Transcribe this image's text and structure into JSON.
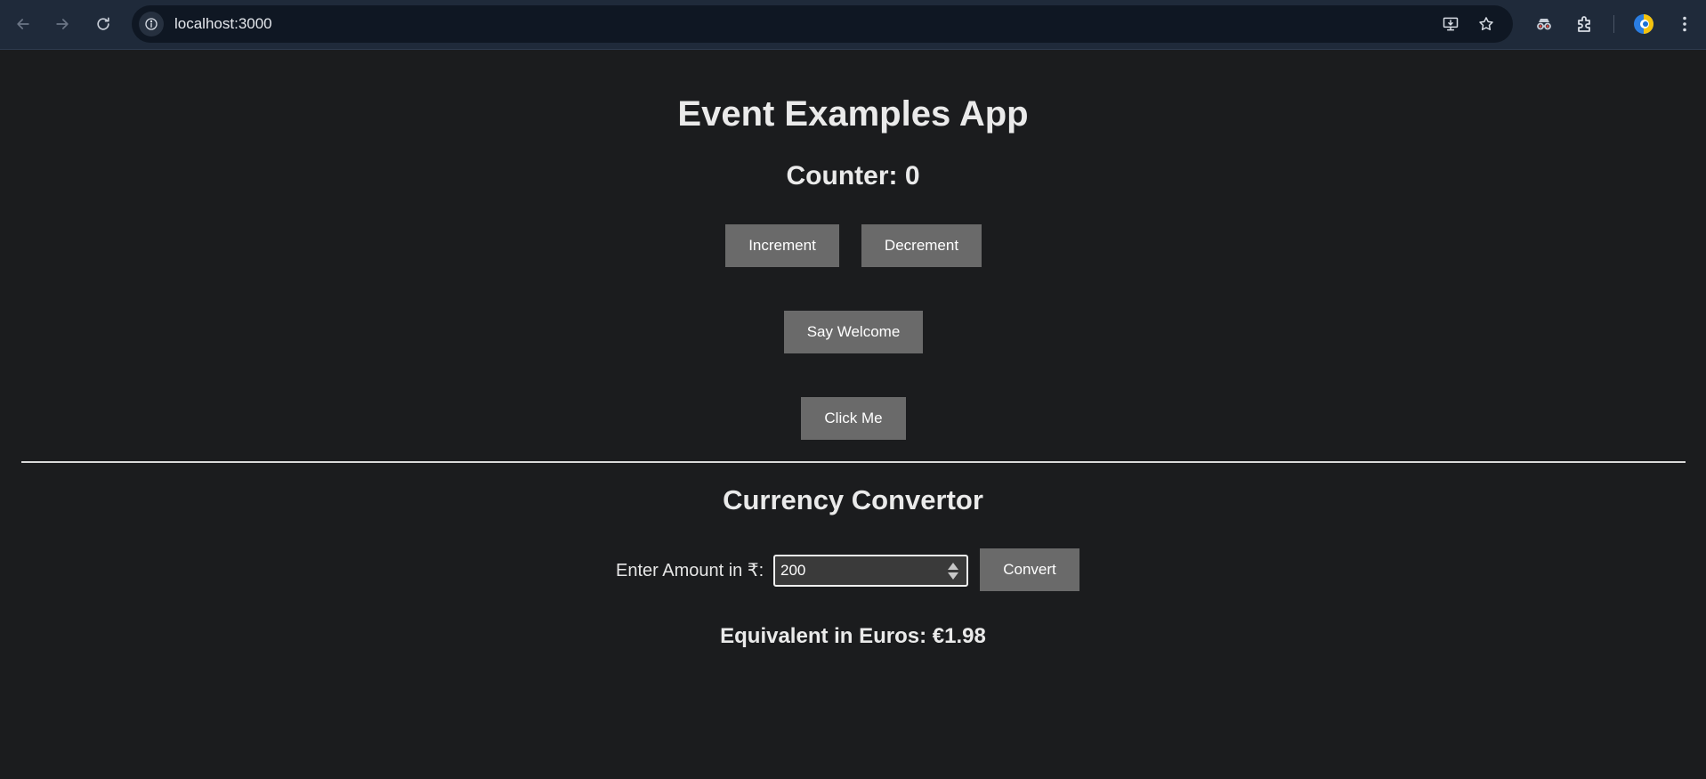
{
  "browser": {
    "url": "localhost:3000"
  },
  "app": {
    "title": "Event Examples App",
    "counter_text": "Counter: 0",
    "buttons": {
      "increment": "Increment",
      "decrement": "Decrement",
      "say_welcome": "Say Welcome",
      "click_me": "Click Me"
    }
  },
  "currency": {
    "section_title": "Currency Convertor",
    "amount_label": "Enter Amount in ₹:",
    "amount_value": "200",
    "convert_label": "Convert",
    "result_text": "Equivalent in Euros: €1.98"
  },
  "colors": {
    "page_background": "#1b1c1e",
    "button_background": "#6a6a6a",
    "chrome_background": "#1f2a3a"
  }
}
